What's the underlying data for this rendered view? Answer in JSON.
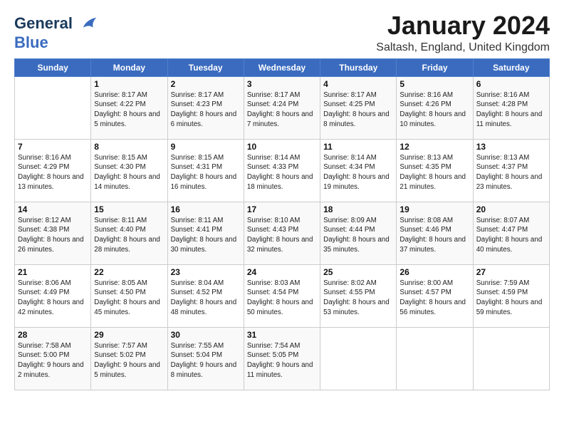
{
  "header": {
    "logo_line1": "General",
    "logo_line2": "Blue",
    "month_title": "January 2024",
    "subtitle": "Saltash, England, United Kingdom"
  },
  "weekdays": [
    "Sunday",
    "Monday",
    "Tuesday",
    "Wednesday",
    "Thursday",
    "Friday",
    "Saturday"
  ],
  "weeks": [
    [
      {
        "day": "",
        "sunrise": "",
        "sunset": "",
        "daylight": ""
      },
      {
        "day": "1",
        "sunrise": "Sunrise: 8:17 AM",
        "sunset": "Sunset: 4:22 PM",
        "daylight": "Daylight: 8 hours and 5 minutes."
      },
      {
        "day": "2",
        "sunrise": "Sunrise: 8:17 AM",
        "sunset": "Sunset: 4:23 PM",
        "daylight": "Daylight: 8 hours and 6 minutes."
      },
      {
        "day": "3",
        "sunrise": "Sunrise: 8:17 AM",
        "sunset": "Sunset: 4:24 PM",
        "daylight": "Daylight: 8 hours and 7 minutes."
      },
      {
        "day": "4",
        "sunrise": "Sunrise: 8:17 AM",
        "sunset": "Sunset: 4:25 PM",
        "daylight": "Daylight: 8 hours and 8 minutes."
      },
      {
        "day": "5",
        "sunrise": "Sunrise: 8:16 AM",
        "sunset": "Sunset: 4:26 PM",
        "daylight": "Daylight: 8 hours and 10 minutes."
      },
      {
        "day": "6",
        "sunrise": "Sunrise: 8:16 AM",
        "sunset": "Sunset: 4:28 PM",
        "daylight": "Daylight: 8 hours and 11 minutes."
      }
    ],
    [
      {
        "day": "7",
        "sunrise": "Sunrise: 8:16 AM",
        "sunset": "Sunset: 4:29 PM",
        "daylight": "Daylight: 8 hours and 13 minutes."
      },
      {
        "day": "8",
        "sunrise": "Sunrise: 8:15 AM",
        "sunset": "Sunset: 4:30 PM",
        "daylight": "Daylight: 8 hours and 14 minutes."
      },
      {
        "day": "9",
        "sunrise": "Sunrise: 8:15 AM",
        "sunset": "Sunset: 4:31 PM",
        "daylight": "Daylight: 8 hours and 16 minutes."
      },
      {
        "day": "10",
        "sunrise": "Sunrise: 8:14 AM",
        "sunset": "Sunset: 4:33 PM",
        "daylight": "Daylight: 8 hours and 18 minutes."
      },
      {
        "day": "11",
        "sunrise": "Sunrise: 8:14 AM",
        "sunset": "Sunset: 4:34 PM",
        "daylight": "Daylight: 8 hours and 19 minutes."
      },
      {
        "day": "12",
        "sunrise": "Sunrise: 8:13 AM",
        "sunset": "Sunset: 4:35 PM",
        "daylight": "Daylight: 8 hours and 21 minutes."
      },
      {
        "day": "13",
        "sunrise": "Sunrise: 8:13 AM",
        "sunset": "Sunset: 4:37 PM",
        "daylight": "Daylight: 8 hours and 23 minutes."
      }
    ],
    [
      {
        "day": "14",
        "sunrise": "Sunrise: 8:12 AM",
        "sunset": "Sunset: 4:38 PM",
        "daylight": "Daylight: 8 hours and 26 minutes."
      },
      {
        "day": "15",
        "sunrise": "Sunrise: 8:11 AM",
        "sunset": "Sunset: 4:40 PM",
        "daylight": "Daylight: 8 hours and 28 minutes."
      },
      {
        "day": "16",
        "sunrise": "Sunrise: 8:11 AM",
        "sunset": "Sunset: 4:41 PM",
        "daylight": "Daylight: 8 hours and 30 minutes."
      },
      {
        "day": "17",
        "sunrise": "Sunrise: 8:10 AM",
        "sunset": "Sunset: 4:43 PM",
        "daylight": "Daylight: 8 hours and 32 minutes."
      },
      {
        "day": "18",
        "sunrise": "Sunrise: 8:09 AM",
        "sunset": "Sunset: 4:44 PM",
        "daylight": "Daylight: 8 hours and 35 minutes."
      },
      {
        "day": "19",
        "sunrise": "Sunrise: 8:08 AM",
        "sunset": "Sunset: 4:46 PM",
        "daylight": "Daylight: 8 hours and 37 minutes."
      },
      {
        "day": "20",
        "sunrise": "Sunrise: 8:07 AM",
        "sunset": "Sunset: 4:47 PM",
        "daylight": "Daylight: 8 hours and 40 minutes."
      }
    ],
    [
      {
        "day": "21",
        "sunrise": "Sunrise: 8:06 AM",
        "sunset": "Sunset: 4:49 PM",
        "daylight": "Daylight: 8 hours and 42 minutes."
      },
      {
        "day": "22",
        "sunrise": "Sunrise: 8:05 AM",
        "sunset": "Sunset: 4:50 PM",
        "daylight": "Daylight: 8 hours and 45 minutes."
      },
      {
        "day": "23",
        "sunrise": "Sunrise: 8:04 AM",
        "sunset": "Sunset: 4:52 PM",
        "daylight": "Daylight: 8 hours and 48 minutes."
      },
      {
        "day": "24",
        "sunrise": "Sunrise: 8:03 AM",
        "sunset": "Sunset: 4:54 PM",
        "daylight": "Daylight: 8 hours and 50 minutes."
      },
      {
        "day": "25",
        "sunrise": "Sunrise: 8:02 AM",
        "sunset": "Sunset: 4:55 PM",
        "daylight": "Daylight: 8 hours and 53 minutes."
      },
      {
        "day": "26",
        "sunrise": "Sunrise: 8:00 AM",
        "sunset": "Sunset: 4:57 PM",
        "daylight": "Daylight: 8 hours and 56 minutes."
      },
      {
        "day": "27",
        "sunrise": "Sunrise: 7:59 AM",
        "sunset": "Sunset: 4:59 PM",
        "daylight": "Daylight: 8 hours and 59 minutes."
      }
    ],
    [
      {
        "day": "28",
        "sunrise": "Sunrise: 7:58 AM",
        "sunset": "Sunset: 5:00 PM",
        "daylight": "Daylight: 9 hours and 2 minutes."
      },
      {
        "day": "29",
        "sunrise": "Sunrise: 7:57 AM",
        "sunset": "Sunset: 5:02 PM",
        "daylight": "Daylight: 9 hours and 5 minutes."
      },
      {
        "day": "30",
        "sunrise": "Sunrise: 7:55 AM",
        "sunset": "Sunset: 5:04 PM",
        "daylight": "Daylight: 9 hours and 8 minutes."
      },
      {
        "day": "31",
        "sunrise": "Sunrise: 7:54 AM",
        "sunset": "Sunset: 5:05 PM",
        "daylight": "Daylight: 9 hours and 11 minutes."
      },
      {
        "day": "",
        "sunrise": "",
        "sunset": "",
        "daylight": ""
      },
      {
        "day": "",
        "sunrise": "",
        "sunset": "",
        "daylight": ""
      },
      {
        "day": "",
        "sunrise": "",
        "sunset": "",
        "daylight": ""
      }
    ]
  ]
}
